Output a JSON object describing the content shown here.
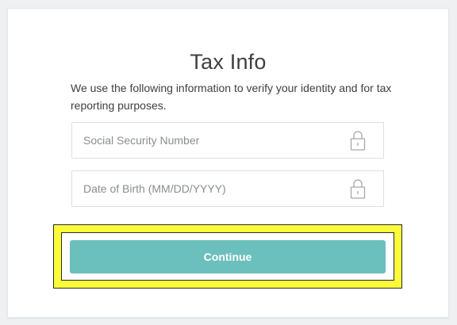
{
  "form": {
    "title": "Tax Info",
    "description": "We use the following information to verify your identity and for tax reporting purposes.",
    "fields": [
      {
        "placeholder": "Social Security Number",
        "value": "",
        "icon": "lock-icon"
      },
      {
        "placeholder": "Date of Birth (MM/DD/YYYY)",
        "value": "",
        "icon": "lock-icon"
      }
    ],
    "continue_label": "Continue"
  },
  "colors": {
    "button": "#6bbfbc",
    "highlight": "#fbfb3a",
    "text": "#3d3f42",
    "placeholder": "#8a8d90"
  }
}
